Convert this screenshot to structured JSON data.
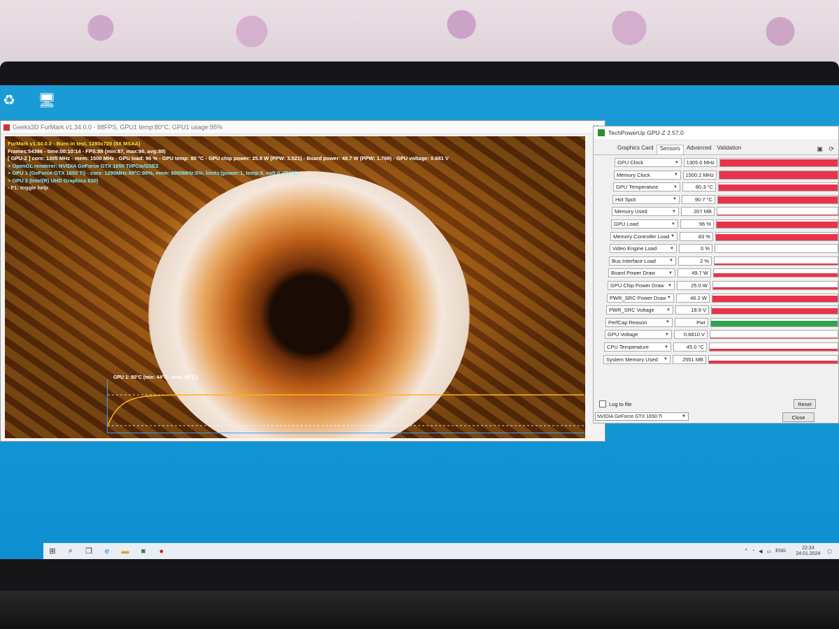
{
  "furmark": {
    "window_title": "Geeks3D FurMark v1.34.0.0 - 88FPS, GPU1 temp:80°C, GPU1 usage:95%",
    "overlay": [
      {
        "text": "FurMark v1.34.0.0 - Burn-in test, 1280x720 (8X MSAA)",
        "color": "yellow"
      },
      {
        "text": "Frames:54386 - time:00:10:14 - FPS:88 (min:87, max:96, avg:88)",
        "color": "white"
      },
      {
        "text": "[ GPU-Z ] core: 1305 MHz - mem: 1500 MHz - GPU load: 96 % - GPU temp: 80 °C - GPU chip power: 25.8 W (PPW: 3.521) - Board power: 49.7 W (PPW: 1.769) - GPU voltage: 0.681 V",
        "color": "white"
      },
      {
        "text": "> OpenGL renderer: NVIDIA GeForce GTX 1650 Ti/PCIe/SSE2",
        "color": "cyan"
      },
      {
        "text": "> GPU 1 (GeForce GTX 1650 Ti) - core: 1290MHz:80°C:96%, mem: 6000MHz:5%, limits:[power:1, temp:0, volt:0, OV:0]",
        "color": "cyan"
      },
      {
        "text": "> GPU 2 (Intel(R) UHD Graphics 630)",
        "color": "cyan"
      },
      {
        "text": "- F1: toggle help",
        "color": "gray"
      }
    ],
    "temp_graph_label": "GPU 1: 80°C (min: 44°C - max: 80°C)",
    "temp_graph": {
      "min": 44,
      "max": 80,
      "current": 80
    }
  },
  "gpuz": {
    "title": "TechPowerUp GPU-Z 2.57.0",
    "tabs": [
      "Graphics Card",
      "Sensors",
      "Advanced",
      "Validation"
    ],
    "active_tab": "Sensors",
    "sensors": [
      {
        "name": "GPU Clock",
        "value": "1305.0 MHz",
        "level": 0.92,
        "color": "#e8334a"
      },
      {
        "name": "Memory Clock",
        "value": "1500.2 MHz",
        "level": 0.92,
        "color": "#e8334a"
      },
      {
        "name": "GPU Temperature",
        "value": "80.3 °C",
        "level": 0.85,
        "color": "#e8334a"
      },
      {
        "name": "Hot Spot",
        "value": "90.7 °C",
        "level": 0.88,
        "color": "#e8334a"
      },
      {
        "name": "Memory Used",
        "value": "207 MB",
        "level": 0.05,
        "color": "#e8334a"
      },
      {
        "name": "GPU Load",
        "value": "96 %",
        "level": 0.8,
        "color": "#e8334a"
      },
      {
        "name": "Memory Controller Load",
        "value": "83 %",
        "level": 0.75,
        "color": "#e8334a"
      },
      {
        "name": "Video Engine Load",
        "value": "0 %",
        "level": 0,
        "color": "#e8334a"
      },
      {
        "name": "Bus Interface Load",
        "value": "2 %",
        "level": 0.02,
        "color": "#e8334a"
      },
      {
        "name": "Board Power Draw",
        "value": "49.7 W",
        "level": 0.45,
        "color": "#e8334a"
      },
      {
        "name": "GPU Chip Power Draw",
        "value": "25.0 W",
        "level": 0.25,
        "color": "#e8334a"
      },
      {
        "name": "PWR_SRC Power Draw",
        "value": "46.2 W",
        "level": 0.75,
        "color": "#e8334a"
      },
      {
        "name": "PWR_SRC Voltage",
        "value": "18.9 V",
        "level": 0.75,
        "color": "#e8334a"
      },
      {
        "name": "PerfCap Reason",
        "value": "Pwr",
        "level": 0.75,
        "color": "#2ea44f"
      },
      {
        "name": "GPU Voltage",
        "value": "0.6810 V",
        "level": 0.12,
        "color": "#e8334a"
      },
      {
        "name": "CPU Temperature",
        "value": "45.0 °C",
        "level": 0.25,
        "color": "#e8334a"
      },
      {
        "name": "System Memory Used",
        "value": "2551 MB",
        "level": 0.3,
        "color": "#e8334a"
      }
    ],
    "log_to_file": "Log to file",
    "reset": "Reset",
    "device": "NVIDIA GeForce GTX 1650 Ti",
    "close": "Close"
  },
  "taskbar": {
    "language": "ENG",
    "time": "22:33",
    "date": "24.01.2024"
  }
}
